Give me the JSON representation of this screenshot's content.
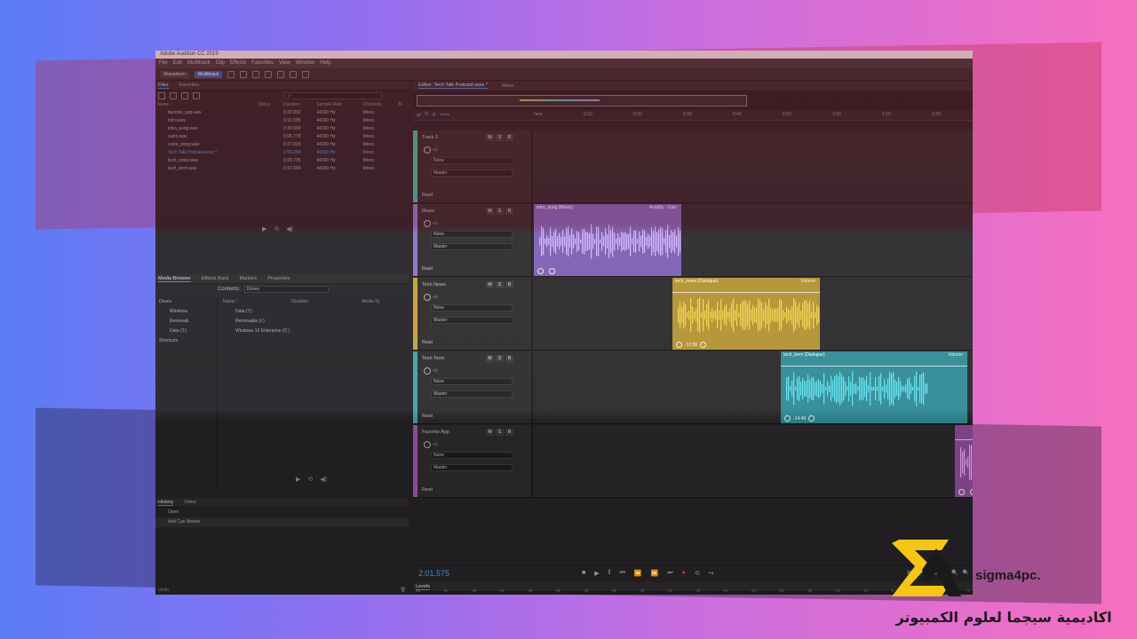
{
  "window_title": "Adobe Audition CC 2019",
  "menu": [
    "File",
    "Edit",
    "Multitrack",
    "Clip",
    "Effects",
    "Favorites",
    "View",
    "Window",
    "Help"
  ],
  "toolbar": {
    "waveform_label": "Waveform",
    "multitrack_label": "Multitrack"
  },
  "files_panel": {
    "tabs": [
      "Files",
      "Favorites"
    ],
    "search_placeholder": "ρ-",
    "columns": [
      "Name ↑",
      "Status",
      "Duration",
      "Sample Rate",
      "Channels",
      "Bi"
    ],
    "rows": [
      {
        "name": "favorite_app.wav",
        "status": "",
        "duration": "0:32.902",
        "rate": "44100 Hz",
        "channels": "Mono"
      },
      {
        "name": "intro.wav",
        "status": "",
        "duration": "0:16.595",
        "rate": "44100 Hz",
        "channels": "Mono"
      },
      {
        "name": "intro_song.wav",
        "status": "",
        "duration": "0:30.000",
        "rate": "44100 Hz",
        "channels": "Mono"
      },
      {
        "name": "outro.wav",
        "status": "",
        "duration": "0:06.778",
        "rate": "44100 Hz",
        "channels": "Mono"
      },
      {
        "name": "outro_song.wav",
        "status": "",
        "duration": "0:27.915",
        "rate": "44100 Hz",
        "channels": "Mono"
      },
      {
        "name": "Tech Talk Podcast.sesx *",
        "status": "",
        "duration": "2:56.256",
        "rate": "44100 Hz",
        "channels": "Mono"
      },
      {
        "name": "tech_news.wav",
        "status": "",
        "duration": "0:29.735",
        "rate": "44100 Hz",
        "channels": "Mono"
      },
      {
        "name": "tech_term.wav",
        "status": "",
        "duration": "0:37.694",
        "rate": "44100 Hz",
        "channels": "Mono"
      }
    ]
  },
  "media_browser": {
    "tabs": [
      "Media Browser",
      "Effects Rack",
      "Markers",
      "Properties"
    ],
    "contents_label": "Contents:",
    "contents_value": "Drives",
    "tree": [
      "Drives",
      "Windows",
      "Removab",
      "Data (T:)",
      "Shortcuts"
    ],
    "list_columns": [
      "Name ↑",
      "Duration",
      "Media Ty"
    ],
    "list_rows": [
      "Data (T:)",
      "Removable (I:)",
      "Windows 10 Enterprise (C:)"
    ]
  },
  "history": {
    "tabs": [
      "History",
      "Video"
    ],
    "items": [
      "Open",
      "Add Cue Marker"
    ],
    "undo_label": "Undo"
  },
  "editor": {
    "tabs": [
      "Editor: Tech Talk Podcast.sesx *",
      "Mixer"
    ],
    "ruler": [
      "hms",
      "0:10",
      "0:20",
      "0:30",
      "0:40",
      "0:50",
      "1:00",
      "1:10",
      "1:20"
    ]
  },
  "tracks": [
    {
      "name": "Track 1",
      "vol": "+0",
      "input": "None",
      "output": "Master",
      "mode": "Read",
      "color": "#3fb49a",
      "clip": null
    },
    {
      "name": "Music",
      "vol": "+0",
      "input": "None",
      "output": "Master",
      "mode": "Read",
      "color": "#8c6fc7",
      "clip": {
        "title": "intro_song (Music)",
        "fx": "Amplify : Gain",
        "color": "#7a5fb2",
        "wave": "#d6b8ff",
        "foot": ""
      }
    },
    {
      "name": "Tech News",
      "vol": "+0",
      "input": "None",
      "output": "Master",
      "mode": "Read",
      "color": "#c6a03a",
      "clip": {
        "title": "tech_news (Dialogue)",
        "fx": "Volume",
        "color": "#b39130",
        "wave": "#f2d54a",
        "foot": "-17.00"
      }
    },
    {
      "name": "Tech Term",
      "vol": "+0",
      "input": "None",
      "output": "Master",
      "mode": "Read",
      "color": "#3ea0ad",
      "clip": {
        "title": "tech_term (Dialogue)",
        "fx": "Volume",
        "color": "#2f8a95",
        "wave": "#5fe6f2",
        "foot": "-14.49"
      }
    },
    {
      "name": "Favorite App",
      "vol": "+0",
      "input": "None",
      "output": "Master",
      "mode": "Read",
      "color": "#9b55a8",
      "clip": {
        "title": "",
        "fx": "",
        "color": "#8a4a96",
        "wave": "#e3a4f0",
        "foot": ""
      }
    }
  ],
  "transport": {
    "timecode": "2:01.575"
  },
  "levels": {
    "title": "Levels",
    "scale": [
      "dB",
      "-57",
      "-54",
      "-51",
      "-48",
      "-45",
      "-42",
      "-39",
      "-36",
      "-33",
      "-30",
      "-27",
      "-24",
      "-21",
      "-18",
      "-15",
      "-12",
      "-9",
      "-6",
      "-3",
      "0"
    ]
  },
  "brand": {
    "name": "sigma4pc.",
    "arabic": "اكاديمية سيجما لعلوم الكمبيوتر",
    "color": "#f5c518"
  }
}
